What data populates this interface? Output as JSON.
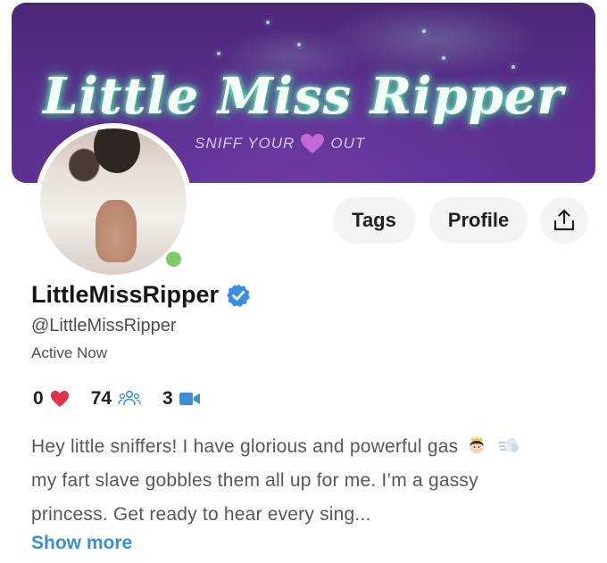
{
  "banner": {
    "title": "Little Miss Ripper",
    "tagline_left": "SNIFF YOUR",
    "tagline_right": "OUT"
  },
  "actions": {
    "tags_label": "Tags",
    "profile_label": "Profile",
    "share_icon": "share-icon"
  },
  "profile": {
    "display_name": "LittleMissRipper",
    "handle": "@LittleMissRipper",
    "status": "Active Now",
    "online": true
  },
  "stats": {
    "likes": "0",
    "subscribers": "74",
    "videos": "3"
  },
  "bio": {
    "line1": "Hey little sniffers! I have glorious and powerful gas",
    "line2": "my fart slave gobbles them all up for me. I’m a gassy",
    "line3": "princess. Get ready to hear every sing...",
    "show_more": "Show more"
  },
  "colors": {
    "accent": "#3b8fd8",
    "heart": "#e0334a",
    "online": "#7ec96a",
    "verified": "#3a8ee6"
  }
}
